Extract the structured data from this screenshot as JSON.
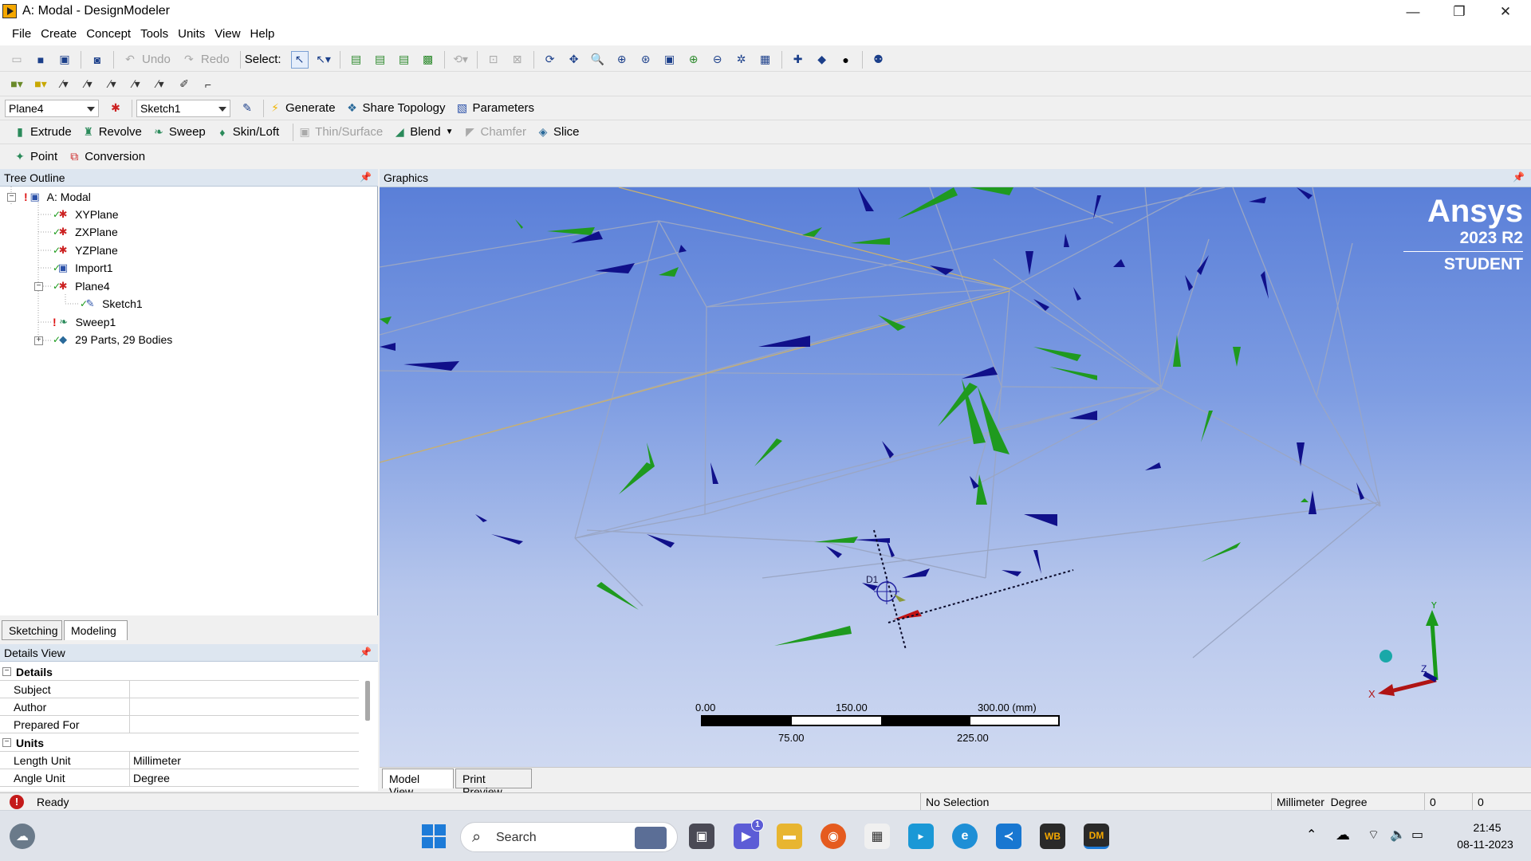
{
  "window": {
    "title": "A: Modal - DesignModeler",
    "minimize": "—",
    "restore": "❐",
    "close": "✕"
  },
  "menu": [
    "File",
    "Create",
    "Concept",
    "Tools",
    "Units",
    "View",
    "Help"
  ],
  "toolbar1": {
    "undo": "Undo",
    "redo": "Redo",
    "select": "Select:"
  },
  "toolbar3": {
    "plane_combo": "Plane4",
    "sketch_combo": "Sketch1",
    "generate": "Generate",
    "share_topology": "Share Topology",
    "parameters": "Parameters"
  },
  "toolbar4": {
    "extrude": "Extrude",
    "revolve": "Revolve",
    "sweep": "Sweep",
    "skin_loft": "Skin/Loft",
    "thin_surface": "Thin/Surface",
    "blend": "Blend",
    "chamfer": "Chamfer",
    "slice": "Slice"
  },
  "toolbar5": {
    "point": "Point",
    "conversion": "Conversion"
  },
  "tree": {
    "header": "Tree Outline",
    "items": [
      {
        "label": "A: Modal"
      },
      {
        "label": "XYPlane"
      },
      {
        "label": "ZXPlane"
      },
      {
        "label": "YZPlane"
      },
      {
        "label": "Import1"
      },
      {
        "label": "Plane4"
      },
      {
        "label": "Sketch1"
      },
      {
        "label": "Sweep1"
      },
      {
        "label": "29 Parts, 29 Bodies"
      }
    ]
  },
  "mode_tabs": {
    "sketching": "Sketching",
    "modeling": "Modeling"
  },
  "details": {
    "header": "Details View",
    "groups": [
      {
        "name": "Details",
        "rows": [
          {
            "key": "Subject",
            "value": ""
          },
          {
            "key": "Author",
            "value": ""
          },
          {
            "key": "Prepared For",
            "value": ""
          }
        ]
      },
      {
        "name": "Units",
        "rows": [
          {
            "key": "Length Unit",
            "value": "Millimeter"
          },
          {
            "key": "Angle Unit",
            "value": "Degree"
          }
        ]
      }
    ]
  },
  "graphics": {
    "header": "Graphics",
    "logo": {
      "brand": "Ansys",
      "version": "2023 R2",
      "edition": "STUDENT"
    },
    "scale": {
      "top": [
        "0.00",
        "150.00",
        "300.00 (mm)"
      ],
      "bottom": [
        "75.00",
        "225.00"
      ]
    },
    "axes": {
      "x": "X",
      "y": "Y",
      "z": "Z"
    },
    "point_label": "D1"
  },
  "view_tabs": {
    "model_view": "Model View",
    "print_preview": "Print Preview"
  },
  "status": {
    "state": "Ready",
    "selection": "No Selection",
    "units": "Millimeter  Degree",
    "v1": "0",
    "v2": "0"
  },
  "taskbar": {
    "search_placeholder": "Search",
    "teams_badge": "1",
    "time": "21:45",
    "date": "08-11-2023",
    "wb": "WB",
    "dm": "DM"
  }
}
